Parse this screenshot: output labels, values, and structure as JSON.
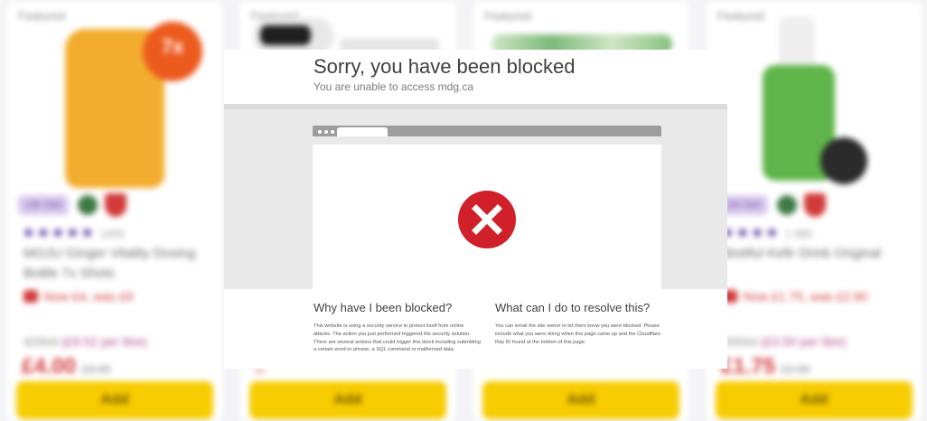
{
  "background": {
    "cards": [
      {
        "featured": "Featured",
        "badge": "7x",
        "pill": "Life Diet",
        "stars": "★★★★★",
        "review_count": "1405",
        "name": "MOJU Ginger Vitality Dosing Bottle 7x Shots",
        "offer": "Now £4, was £6",
        "size": "420ml",
        "per_unit": "(£9.52 per litre)",
        "price": "£4.00",
        "was_price": "£6.00",
        "add_label": "Add",
        "image_color": "#f3ad2e"
      },
      {
        "featured": "Featured",
        "add_label": "Add"
      },
      {
        "featured": "Featured",
        "add_label": "Add"
      },
      {
        "featured": "Featured",
        "pill": "Life Diet",
        "stars": "★★★★",
        "review_count": "1 995",
        "name": "Biotiful Kefir Drink Original",
        "offer": "Now £1.75, was £2.60",
        "size": "500ml",
        "per_unit": "(£3.50 per litre)",
        "price": "£1.75",
        "was_price": "£2.60",
        "add_label": "Add",
        "image_color": "#5fb54a"
      }
    ]
  },
  "block_page": {
    "title": "Sorry, you have been blocked",
    "subtitle": "You are unable to access mdg.ca",
    "error_icon": "x-circle-icon",
    "error_color": "#d0202a",
    "why_heading": "Why have I been blocked?",
    "why_text": "This website is using a security service to protect itself from online attacks. The action you just performed triggered the security solution. There are several actions that could trigger this block including submitting a certain word or phrase, a SQL command or malformed data.",
    "resolve_heading": "What can I do to resolve this?",
    "resolve_text": "You can email the site owner to let them know you were blocked. Please include what you were doing when this page came up and the Cloudflare Ray ID found at the bottom of this page."
  }
}
